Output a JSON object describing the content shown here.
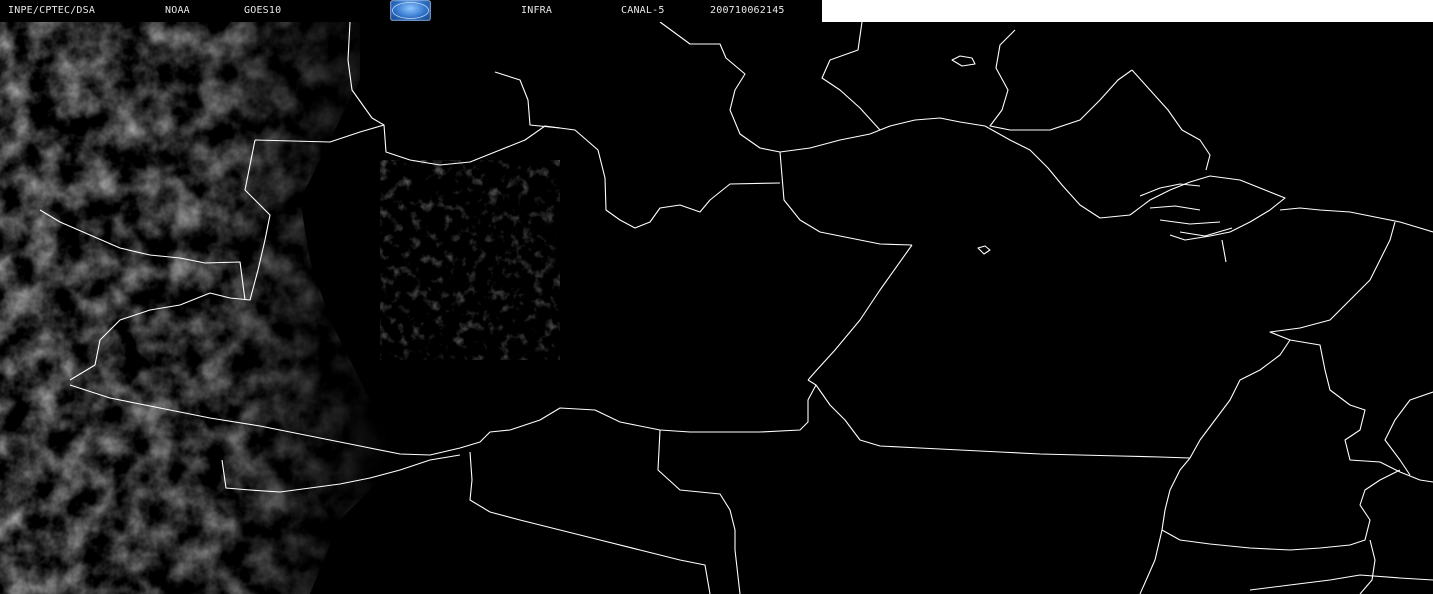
{
  "header": {
    "source": "INPE/CPTEC/DSA",
    "agency": "NOAA",
    "satellite": "GOES10",
    "logo_text": "CPTEC",
    "band": "INFRA",
    "channel": "CANAL-5",
    "timestamp": "200710062145"
  },
  "colors": {
    "background": "#000000",
    "borders": "#ffffff",
    "clouds": "#8a8a8a",
    "header_block": "#ffffff"
  }
}
